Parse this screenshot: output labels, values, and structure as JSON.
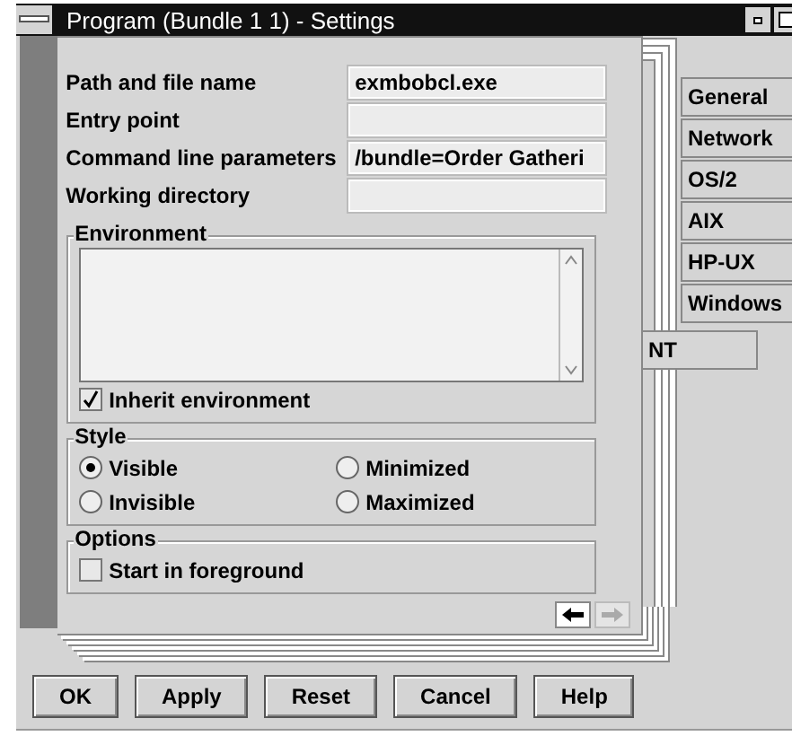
{
  "window": {
    "title": "Program (Bundle 1 1) - Settings"
  },
  "fields": [
    {
      "label": "Path and file name",
      "value": "exmbobcl.exe"
    },
    {
      "label": "Entry point"
    },
    {
      "label": "Command line parameters",
      "value": "/bundle=Order Gatheri"
    },
    {
      "label": "Working directory"
    }
  ],
  "environment": {
    "title": "Environment",
    "inherit": {
      "label": "Inherit environment",
      "checked": true
    }
  },
  "style": {
    "title": "Style",
    "options": [
      {
        "label": "Visible",
        "selected": true
      },
      {
        "label": "Minimized",
        "selected": false
      },
      {
        "label": "Invisible",
        "selected": false
      },
      {
        "label": "Maximized",
        "selected": false
      }
    ]
  },
  "options": {
    "title": "Options",
    "items": [
      {
        "label": "Start in foreground",
        "checked": false
      }
    ]
  },
  "page_arrows": [
    {
      "kind": "back",
      "disabled": false
    },
    {
      "kind": "forward",
      "disabled": true
    }
  ],
  "tabs": [
    {
      "label": "General",
      "selected": false
    },
    {
      "label": "Network",
      "selected": false
    },
    {
      "label": "OS/2",
      "selected": false
    },
    {
      "label": "AIX",
      "selected": false
    },
    {
      "label": "HP-UX",
      "selected": false
    },
    {
      "label": "Windows",
      "selected": false
    },
    {
      "label": "NT",
      "selected": true
    }
  ],
  "buttons": [
    "OK",
    "Apply",
    "Reset",
    "Cancel",
    "Help"
  ]
}
